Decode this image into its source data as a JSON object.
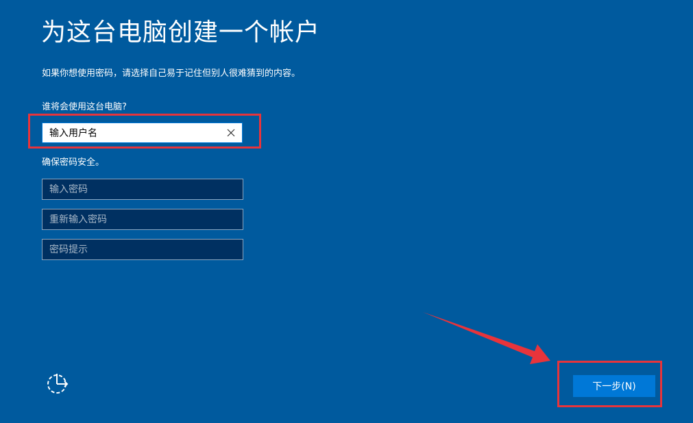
{
  "page": {
    "title": "为这台电脑创建一个帐户",
    "subtitle": "如果你想使用密码，请选择自己易于记住但别人很难猜到的内容。"
  },
  "account": {
    "who_label": "谁将会使用这台电脑?",
    "username_value": "输入用户名",
    "secure_label": "确保密码安全。",
    "password_placeholder": "输入密码",
    "confirm_placeholder": "重新输入密码",
    "hint_placeholder": "密码提示"
  },
  "footer": {
    "next_label": "下一步(N)",
    "accessibility_icon": "ease-of-access-icon"
  },
  "icons": {
    "clear": "close-icon"
  },
  "colors": {
    "background": "#005a9e",
    "field_dark": "#003061",
    "accent": "#0078d7",
    "annotation_red": "#e8343b"
  }
}
